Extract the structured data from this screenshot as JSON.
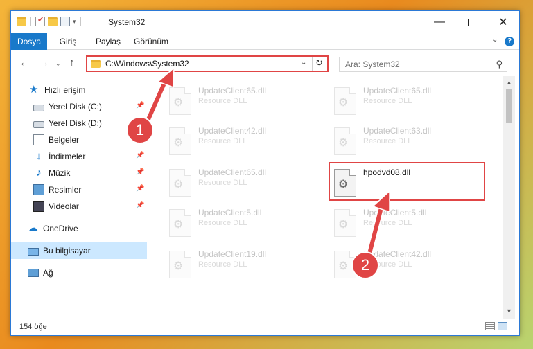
{
  "window": {
    "title": "System32",
    "minimize": "—",
    "close": "✕"
  },
  "qat": {
    "dropdown": "▾"
  },
  "ribbon": {
    "tabs": [
      "Dosya",
      "Giriş",
      "Paylaş",
      "Görünüm"
    ],
    "toggle": "⌄",
    "help": "?"
  },
  "nav": {
    "back": "←",
    "forward": "→",
    "history": "⌄",
    "up": "↑",
    "address": "C:\\Windows\\System32",
    "address_dropdown": "⌄",
    "refresh": "↻",
    "search_placeholder": "Ara: System32",
    "search_icon": "⚲"
  },
  "sidebar": {
    "items": [
      {
        "label": "Hızlı erişim",
        "icon": "star-icon",
        "glyph": "★"
      },
      {
        "label": "Yerel Disk (C:)",
        "icon": "disk-icon",
        "pinned": true
      },
      {
        "label": "Yerel Disk (D:)",
        "icon": "disk-icon"
      },
      {
        "label": "Belgeler",
        "icon": "document-icon"
      },
      {
        "label": "İndirmeler",
        "icon": "download-icon",
        "glyph": "↓",
        "pinned": true
      },
      {
        "label": "Müzik",
        "icon": "music-icon",
        "glyph": "♪",
        "pinned": true
      },
      {
        "label": "Resimler",
        "icon": "pictures-icon",
        "pinned": true
      },
      {
        "label": "Videolar",
        "icon": "videos-icon",
        "pinned": true
      },
      {
        "label": "OneDrive",
        "icon": "cloud-icon",
        "glyph": "☁"
      },
      {
        "label": "Bu bilgisayar",
        "icon": "computer-icon",
        "selected": true
      },
      {
        "label": "Ağ",
        "icon": "network-icon"
      }
    ],
    "pin_glyph": "📌"
  },
  "files": [
    {
      "name": "UpdateClient65.dll",
      "type": "Resource DLL"
    },
    {
      "name": "UpdateClient65.dll",
      "type": "Resource DLL"
    },
    {
      "name": "UpdateClient42.dll",
      "type": "Resource DLL"
    },
    {
      "name": "UpdateClient63.dll",
      "type": "Resource DLL"
    },
    {
      "name": "UpdateClient65.dll",
      "type": "Resource DLL"
    },
    {
      "name": "hpodvd08.dll",
      "type": ""
    },
    {
      "name": "UpdateClient5.dll",
      "type": "Resource DLL"
    },
    {
      "name": "UpdateClient5.dll",
      "type": "Resource DLL"
    },
    {
      "name": "UpdateClient19.dll",
      "type": "Resource DLL"
    },
    {
      "name": "UpdateClient42.dll",
      "type": "Resource DLL"
    }
  ],
  "gear_glyph": "⚙",
  "status": {
    "item_count": "154 öğe"
  },
  "scroll": {
    "up": "▲",
    "down": "▼"
  },
  "annotations": {
    "step1": "1",
    "step2": "2",
    "color": "#e04545"
  }
}
